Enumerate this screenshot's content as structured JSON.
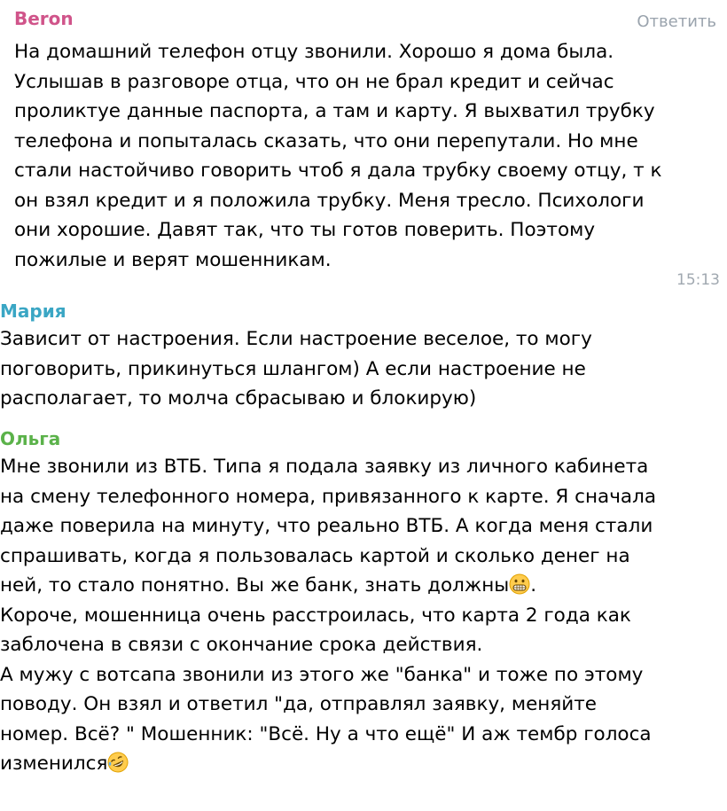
{
  "colors": {
    "beron": "#d0548a",
    "maria": "#3aa6c4",
    "olga": "#5bb24a",
    "muted": "#9aa3ad"
  },
  "messages": [
    {
      "author": "Beron",
      "reply_label": "Ответить",
      "time": "15:13",
      "lines": [
        "На домашний телефон отцу звонили. Хорошо я дома была.",
        "Услышав в разговоре отца, что он не брал кредит и сейчас",
        "проликтуе данные паспорта, а там и карту. Я выхватил трубку",
        "телефона и попыталась сказать, что они перепутали. Но мне",
        "стали настойчиво говорить чтоб я дала трубку своему отцу, т к",
        "он взял кредит и я положила трубку. Меня тресло. Психологи",
        "они хорошие. Давят так, что ты готов поверить. Поэтому",
        "пожилые и верят мошенникам."
      ]
    },
    {
      "author": "Мария",
      "lines": [
        "Зависит от настроения. Если настроение веселое, то могу",
        "поговорить, прикинуться шлангом) А если настроение не",
        "располагает, то молча сбрасываю и блокирую)"
      ]
    },
    {
      "author": "Ольга",
      "lines": [
        "Мне звонили из ВТБ. Типа я подала заявку из личного кабинета",
        "на смену телефонного номера, привязанного к карте. Я сначала",
        "даже поверила на минуту, что реально ВТБ. А когда меня стали",
        "спрашивать, когда я пользовалась картой и сколько денег на",
        "ней, то стало понятно. Вы же банк, знать должны",
        ".",
        "Короче, мошенница очень расстроилась, что карта 2 года как",
        "заблочена в связи с окончание срока действия.",
        "А мужу с вотсапа звонили из этого же \"банка\" и тоже по этому",
        "поводу. Он взял и ответил \"да, отправлял заявку, меняйте",
        "номер. Всё? \" Мошенник: \"Всё. Ну а что ещё\" И аж тембр голоса",
        "изменился"
      ],
      "emojis": [
        "grimacing-face-emoji",
        "rolling-laughing-emoji"
      ]
    }
  ]
}
